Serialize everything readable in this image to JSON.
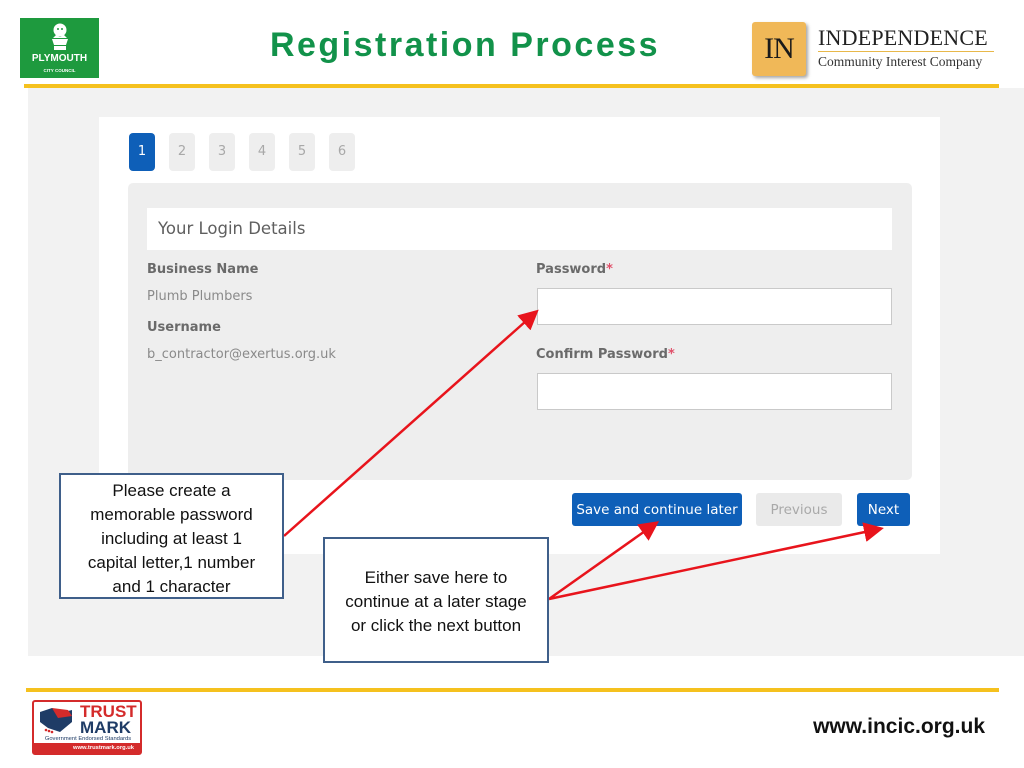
{
  "header": {
    "title": "Registration Process",
    "left_logo": {
      "name": "PLYMOUTH",
      "subtitle": "CITY COUNCIL",
      "color": "#1e9a3e"
    },
    "right_logo": {
      "mark": "IN",
      "name": "INDEPENDENCE",
      "subtitle": "Community Interest Company",
      "color": "#f0b858"
    },
    "accent_color": "#f5c11e",
    "title_color": "#12924a"
  },
  "wizard": {
    "steps": [
      {
        "label": "1",
        "active": true
      },
      {
        "label": "2",
        "active": false
      },
      {
        "label": "3",
        "active": false
      },
      {
        "label": "4",
        "active": false
      },
      {
        "label": "5",
        "active": false
      },
      {
        "label": "6",
        "active": false
      }
    ],
    "panel_title": "Your Login Details",
    "business_name_label": "Business Name",
    "business_name_value": "Plumb Plumbers",
    "username_label": "Username",
    "username_value": "b_contractor@exertus.org.uk",
    "password_label": "Password",
    "password_value": "",
    "confirm_password_label": "Confirm Password",
    "confirm_password_value": "",
    "required_marker": "*",
    "buttons": {
      "save_later": "Save and continue later",
      "previous": "Previous",
      "next": "Next"
    },
    "primary_color": "#0e5fb8"
  },
  "callouts": {
    "password_hint": [
      "Please create a",
      "memorable password",
      "including at least 1",
      "capital letter,1 number",
      "and 1 character"
    ],
    "save_hint": [
      "Either save here to",
      "continue at a later stage",
      "or click the next button"
    ],
    "arrow_color": "#e8141c"
  },
  "footer": {
    "trustmark": {
      "line1": "TRUST",
      "line2": "MARK",
      "tagline": "Government Endorsed Standards",
      "url": "www.trustmark.org.uk"
    },
    "website": "www.incic.org.uk"
  }
}
